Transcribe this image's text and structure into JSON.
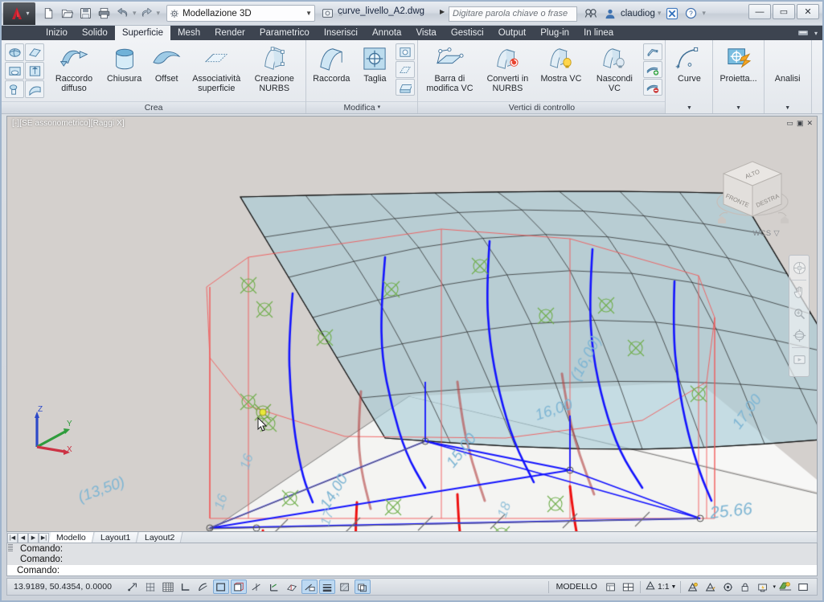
{
  "app": {
    "product_logo": "autocad-logo",
    "workspace": "Modellazione 3D",
    "document_title": "curve_livello_A2.dwg",
    "search_placeholder": "Digitare parola chiave o frase",
    "user_name": "claudiog",
    "window_buttons": {
      "minimize": "—",
      "maximize": "▭",
      "close": "✕"
    }
  },
  "quick_access": [
    {
      "name": "new-file-icon",
      "title": "Nuovo"
    },
    {
      "name": "open-file-icon",
      "title": "Apri"
    },
    {
      "name": "save-icon",
      "title": "Salva"
    },
    {
      "name": "plot-icon",
      "title": "Stampa"
    },
    {
      "name": "undo-icon",
      "title": "Annulla"
    },
    {
      "name": "redo-icon",
      "title": "Ripristina"
    }
  ],
  "ribbon": {
    "tabs": [
      {
        "label": "Inizio",
        "active": false
      },
      {
        "label": "Solido",
        "active": false
      },
      {
        "label": "Superficie",
        "active": true
      },
      {
        "label": "Mesh",
        "active": false
      },
      {
        "label": "Render",
        "active": false
      },
      {
        "label": "Parametrico",
        "active": false
      },
      {
        "label": "Inserisci",
        "active": false
      },
      {
        "label": "Annota",
        "active": false
      },
      {
        "label": "Vista",
        "active": false
      },
      {
        "label": "Gestisci",
        "active": false
      },
      {
        "label": "Output",
        "active": false
      },
      {
        "label": "Plug-in",
        "active": false
      },
      {
        "label": "In linea",
        "active": false
      }
    ],
    "panels": [
      {
        "title": "Crea",
        "small_icons": [
          "network-surface-icon",
          "planar-surface-icon",
          "extrude-surface-icon",
          "loft-surface-icon",
          "revolve-surface-icon",
          "sweep-surface-icon"
        ],
        "buttons": [
          {
            "label": "Raccordo diffuso",
            "icon": "blend-surface-icon"
          },
          {
            "label": "Chiusura",
            "icon": "patch-surface-icon"
          },
          {
            "label": "Offset",
            "icon": "offset-surface-icon"
          },
          {
            "label": "Associatività superficie",
            "icon": "surface-associativity-icon"
          },
          {
            "label": "Creazione NURBS",
            "icon": "nurbs-creation-icon"
          }
        ]
      },
      {
        "title": "Modifica",
        "has_dropdown": true,
        "buttons": [
          {
            "label": "Raccorda",
            "icon": "surface-fillet-icon"
          },
          {
            "label": "Taglia",
            "icon": "surface-trim-icon"
          }
        ],
        "stack_icons": [
          "surface-untrim-icon",
          "surface-extend-icon",
          "surface-sculpt-icon"
        ]
      },
      {
        "title": "Vertici di controllo",
        "buttons": [
          {
            "label": "Barra di modifica VC",
            "icon": "cv-edit-bar-icon"
          },
          {
            "label": "Converti in NURBS",
            "icon": "convert-to-nurbs-icon"
          },
          {
            "label": "Mostra VC",
            "icon": "show-cv-icon"
          },
          {
            "label": "Nascondi VC",
            "icon": "hide-cv-icon"
          }
        ],
        "stack_icons": [
          "cv-rebuild-icon",
          "cv-add-icon",
          "cv-remove-icon"
        ]
      },
      {
        "title": "Curve",
        "buttons": [
          {
            "label": "Curve",
            "icon": "curve-icon"
          }
        ],
        "has_panel_arrow": true
      },
      {
        "title": "Proietta",
        "buttons": [
          {
            "label": "Proietta...",
            "icon": "project-geometry-icon"
          }
        ],
        "has_panel_arrow": true
      },
      {
        "title": "Analisi",
        "buttons": [
          {
            "label": "Analisi",
            "icon": "analysis-icon"
          }
        ],
        "has_panel_arrow": true
      }
    ]
  },
  "viewport": {
    "label": "[-][SE assonometrico][Raggi X]",
    "controls": [
      "minimize-viewport",
      "maximize-viewport",
      "close-viewport"
    ],
    "viewcube": {
      "top_face": "ALTO",
      "front_face": "FRONTE",
      "right_face": "DESTRA",
      "wcs_label": "WCS"
    },
    "navbar_icons": [
      "steering-wheel-icon",
      "pan-hand-icon",
      "zoom-icon",
      "orbit-icon",
      "showmotion-icon"
    ],
    "ucs_axes": {
      "x": "X",
      "y": "Y",
      "z": "Z"
    },
    "colors": {
      "surface_fill": "#a7ccd6",
      "control_polygon": "#f25a5a",
      "contour_blue": "#1414ff",
      "contour_red": "#ee1111",
      "cv_marker_green": "#6fae4a",
      "label_text": "#7fb6d4",
      "background": "#d4d0cd",
      "ground_plane": "#f4f4f2"
    },
    "contour_labels": [
      "(13,50)",
      "14,00",
      "15,00",
      "16,00",
      "(16,00)",
      "17,00",
      "25.66",
      "(18,8"
    ]
  },
  "layout_tabs": {
    "nav_buttons": [
      "first",
      "prev",
      "next",
      "last"
    ],
    "tabs": [
      {
        "label": "Modello",
        "active": true
      },
      {
        "label": "Layout1",
        "active": false
      },
      {
        "label": "Layout2",
        "active": false
      }
    ]
  },
  "command_line": {
    "history": [
      "Comando:",
      "Comando:"
    ],
    "current": "Comando:"
  },
  "status_bar": {
    "coordinates": "13.9189, 50.4354, 0.0000",
    "left_toggles": [
      {
        "name": "infer-constraints-icon",
        "on": false
      },
      {
        "name": "snap-mode-icon",
        "on": false
      },
      {
        "name": "grid-display-icon",
        "on": false
      },
      {
        "name": "ortho-mode-icon",
        "on": false
      },
      {
        "name": "polar-tracking-icon",
        "on": false
      },
      {
        "name": "object-snap-icon",
        "on": true
      },
      {
        "name": "3d-object-snap-icon",
        "on": true
      },
      {
        "name": "object-snap-tracking-icon",
        "on": false
      },
      {
        "name": "ucs-icon-toggle",
        "on": false
      },
      {
        "name": "dynamic-ucs-icon",
        "on": false
      },
      {
        "name": "dynamic-input-icon",
        "on": true
      },
      {
        "name": "lineweight-icon",
        "on": true
      },
      {
        "name": "transparency-icon",
        "on": false
      },
      {
        "name": "selection-cycling-icon",
        "on": true
      }
    ],
    "space_label": "MODELLO",
    "right_toggles": [
      {
        "name": "quick-properties-icon",
        "on": false
      },
      {
        "name": "viewport-layout-icon",
        "on": false
      }
    ],
    "annotation_scale": "1:1",
    "right_icons": [
      {
        "name": "annotation-visibility-icon"
      },
      {
        "name": "auto-scale-icon"
      },
      {
        "name": "workspace-switch-icon"
      },
      {
        "name": "toolbar-lock-icon"
      },
      {
        "name": "hardware-accel-icon"
      },
      {
        "name": "isolate-objects-icon"
      },
      {
        "name": "clean-screen-icon"
      }
    ]
  }
}
